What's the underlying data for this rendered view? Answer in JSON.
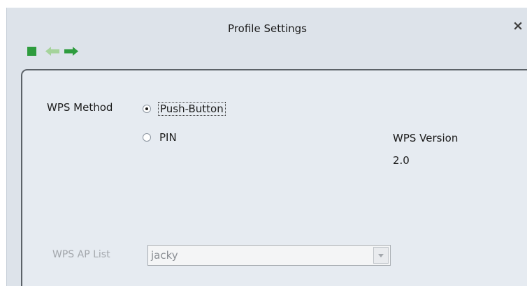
{
  "window": {
    "title": "Profile Settings",
    "close_glyph": "×"
  },
  "toolbar": {
    "stop_icon": "stop-square-icon",
    "back_icon": "arrow-left-icon",
    "forward_icon": "arrow-right-icon",
    "colors": {
      "stop": "#2e9c3e",
      "back": "#a5d39b",
      "forward": "#2e9c3e"
    }
  },
  "wps": {
    "method_label": "WPS Method",
    "options": [
      {
        "label": "Push-Button",
        "selected": true
      },
      {
        "label": "PIN",
        "selected": false
      }
    ],
    "version_label": "WPS Version",
    "version_value": "2.0",
    "ap_list_label": "WPS AP List",
    "ap_list_value": "jacky"
  }
}
